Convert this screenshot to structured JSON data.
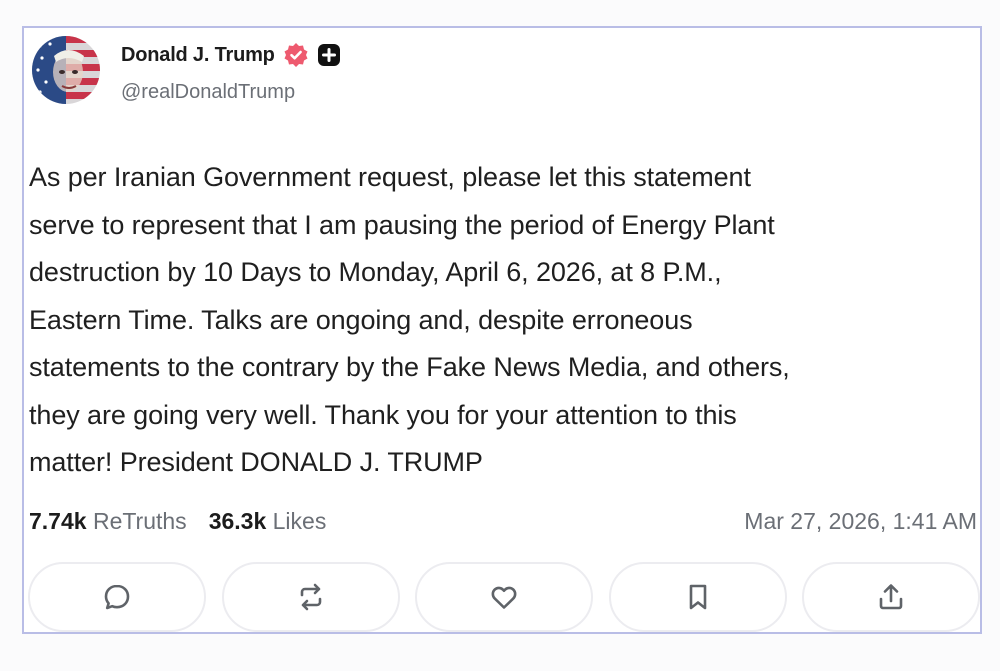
{
  "author": {
    "display_name": "Donald J. Trump",
    "handle": "@realDonaldTrump",
    "avatar_icon": "avatar-flag-portrait",
    "verified_icon": "verified-badge-icon",
    "plus_icon": "plus-badge-icon"
  },
  "post": {
    "text": "As per Iranian Government request, please let this statement\nserve to represent that I am pausing the period of Energy Plant\ndestruction by 10 Days to Monday, April 6, 2026, at 8 P.M.,\nEastern Time. Talks are ongoing and, despite erroneous\nstatements to the contrary by the Fake News Media, and others,\nthey are going very well. Thank you for your attention to this\nmatter! President DONALD J. TRUMP"
  },
  "stats": {
    "retruths_count": "7.74k",
    "retruths_label": "ReTruths",
    "likes_count": "36.3k",
    "likes_label": "Likes",
    "timestamp": "Mar 27, 2026, 1:41 AM"
  },
  "actions": [
    {
      "icon": "reply-icon"
    },
    {
      "icon": "retruth-icon"
    },
    {
      "icon": "like-icon"
    },
    {
      "icon": "bookmark-icon"
    },
    {
      "icon": "share-icon"
    }
  ],
  "colors": {
    "card_border": "#b9bde6",
    "verified_badge": "#ee5a6f",
    "text_primary": "#1f1f1f",
    "text_secondary": "#6b6f76"
  }
}
